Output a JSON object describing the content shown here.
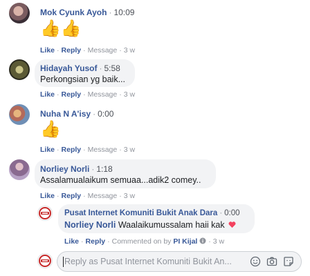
{
  "comments": [
    {
      "name": "Mok Cyunk Ayoh",
      "time": "10:09",
      "content": "👍👍",
      "actions": {
        "like": "Like",
        "reply": "Reply",
        "message": "Message",
        "age": "3 w"
      }
    },
    {
      "name": "Hidayah Yusof",
      "time": "5:58",
      "content": "Perkongsian yg baik...",
      "actions": {
        "like": "Like",
        "reply": "Reply",
        "message": "Message",
        "age": "3 w"
      }
    },
    {
      "name": "Nuha N A'isy",
      "time": "0:00",
      "content": "👍",
      "actions": {
        "like": "Like",
        "reply": "Reply",
        "message": "Message",
        "age": "3 w"
      }
    },
    {
      "name": "Norliey Norli",
      "time": "1:18",
      "content": "Assalamualaikum semuaa...adik2 comey..",
      "actions": {
        "like": "Like",
        "reply": "Reply",
        "message": "Message",
        "age": "3 w"
      }
    }
  ],
  "reply": {
    "name": "Pusat Internet Komuniti Bukit Anak Dara",
    "time": "0:00",
    "tagged": "Norliey Norli",
    "text": "Waalaikumussalam haii kak",
    "actions": {
      "like": "Like",
      "reply": "Reply",
      "commented_by": "Commented on by",
      "page": "PI Kijal",
      "age": "3 w"
    }
  },
  "reply_box": {
    "placeholder": "Reply as Pusat Internet Komuniti Bukit An..."
  },
  "separator": "·",
  "colors": {
    "link": "#385898",
    "bubble": "#f2f3f5",
    "meta": "#90949c",
    "heart": "#f3425f"
  }
}
